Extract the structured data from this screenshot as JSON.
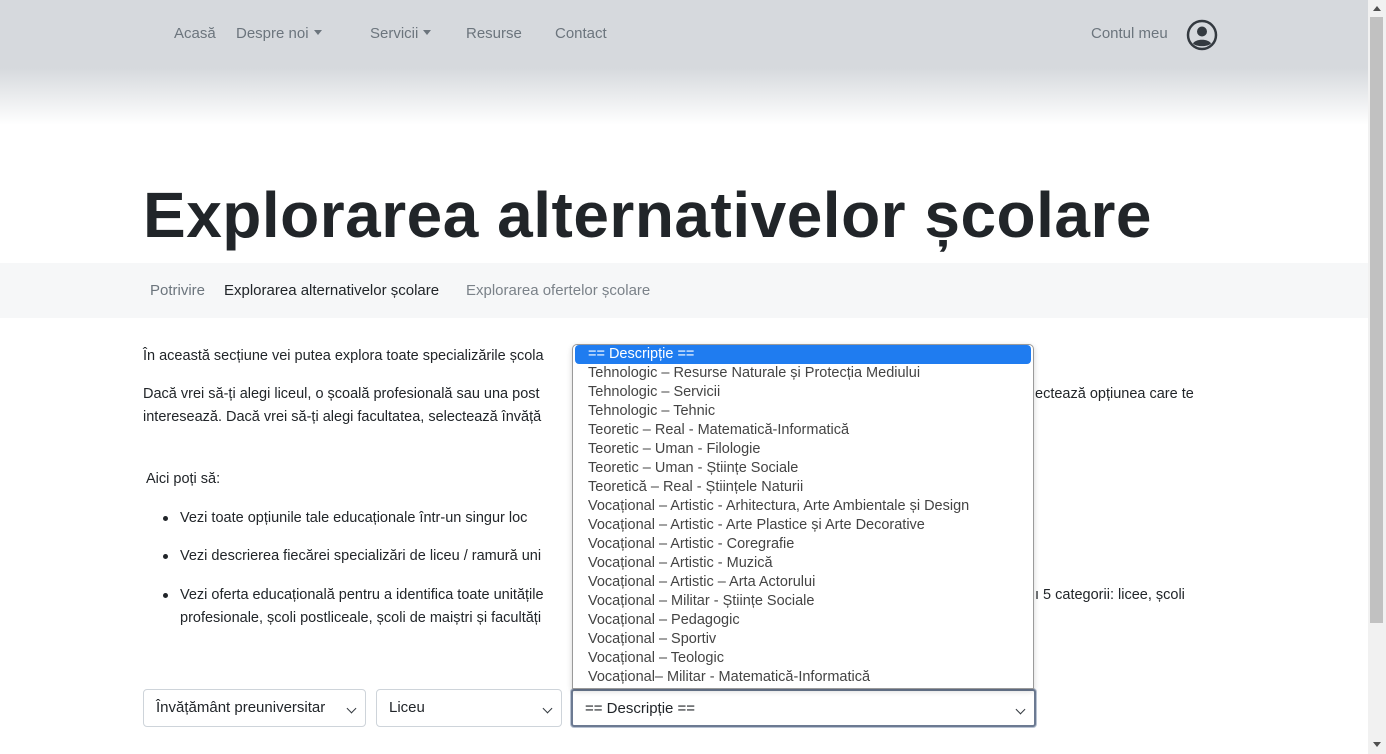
{
  "nav": {
    "items": [
      "Acasă",
      "Despre noi",
      "Servicii",
      "Resurse",
      "Contact"
    ],
    "account": "Contul meu"
  },
  "page": {
    "title": "Explorarea alternativelor școlare"
  },
  "breadcrumb": [
    "Potrivire",
    "Explorarea alternativelor școlare",
    "Explorarea ofertelor școlare"
  ],
  "content": {
    "p1": "În această secțiune vei putea explora toate specializările școla",
    "p2_line1_left": "Dacă vrei să-ți alegi liceul, o școală profesională sau una post",
    "p2_line1_right": "ectează opțiunea care te",
    "p2_line2": "interesează. Dacă vrei să-ți alegi facultatea, selectează învăță",
    "intro": "Aici poți să:",
    "bullets": [
      "Vezi toate opțiunile tale educaționale într-un singur loc",
      "Vezi descrierea fiecărei specializări de liceu / ramură uni",
      "Vezi oferta educațională pentru a identifica toate unitățile"
    ],
    "bullet3_right": "ı 5 categorii: licee, școli",
    "bullet3_line2": "profesionale, școli postliceale, școli de maiștri și facultăți"
  },
  "filters": {
    "level": "Învățământ preuniversitar",
    "type": "Liceu",
    "profile": "== Descripție =="
  },
  "dropdown": {
    "options": [
      "== Descripție ==",
      "Tehnologic – Resurse Naturale și Protecția Mediului",
      "Tehnologic – Servicii",
      "Tehnologic – Tehnic",
      "Teoretic – Real - Matematică-Informatică",
      "Teoretic – Uman - Filologie",
      "Teoretic – Uman - Științe Sociale",
      "Teoretică – Real - Științele Naturii",
      "Vocațional – Artistic - Arhitectura, Arte Ambientale și Design",
      "Vocațional – Artistic - Arte Plastice și Arte Decorative",
      "Vocațional – Artistic - Coregrafie",
      "Vocațional – Artistic - Muzică",
      "Vocațional – Artistic – Arta Actorului",
      "Vocațional – Militar - Științe Sociale",
      "Vocațional – Pedagogic",
      "Vocațional – Sportiv",
      "Vocațional – Teologic",
      "Vocațional– Militar - Matematică-Informatică"
    ]
  }
}
